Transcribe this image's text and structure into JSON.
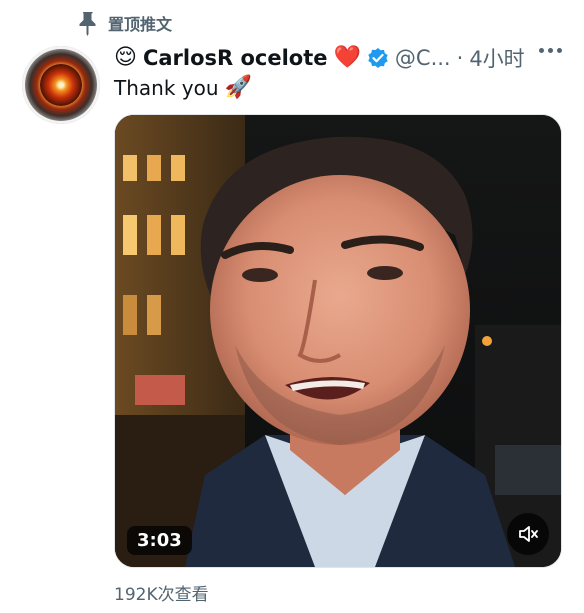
{
  "pinned": {
    "label": "置顶推文",
    "icon": "pin-icon"
  },
  "author": {
    "emoji_prefix": "😌",
    "display_name": "CarlosR ocelote",
    "emoji_suffix": "❤️",
    "verified_icon": "verified-badge-icon",
    "handle": "@C...",
    "separator": "·",
    "time": "4小时",
    "avatar": "avatar"
  },
  "tweet": {
    "text": "Thank you",
    "emoji": "🚀"
  },
  "media": {
    "duration": "3:03",
    "mute_icon": "mute-icon"
  },
  "views": "192K次查看",
  "colors": {
    "text": "#0f1419",
    "secondary": "#536471",
    "verified": "#1d9bf0",
    "heart": "#e0245e"
  }
}
